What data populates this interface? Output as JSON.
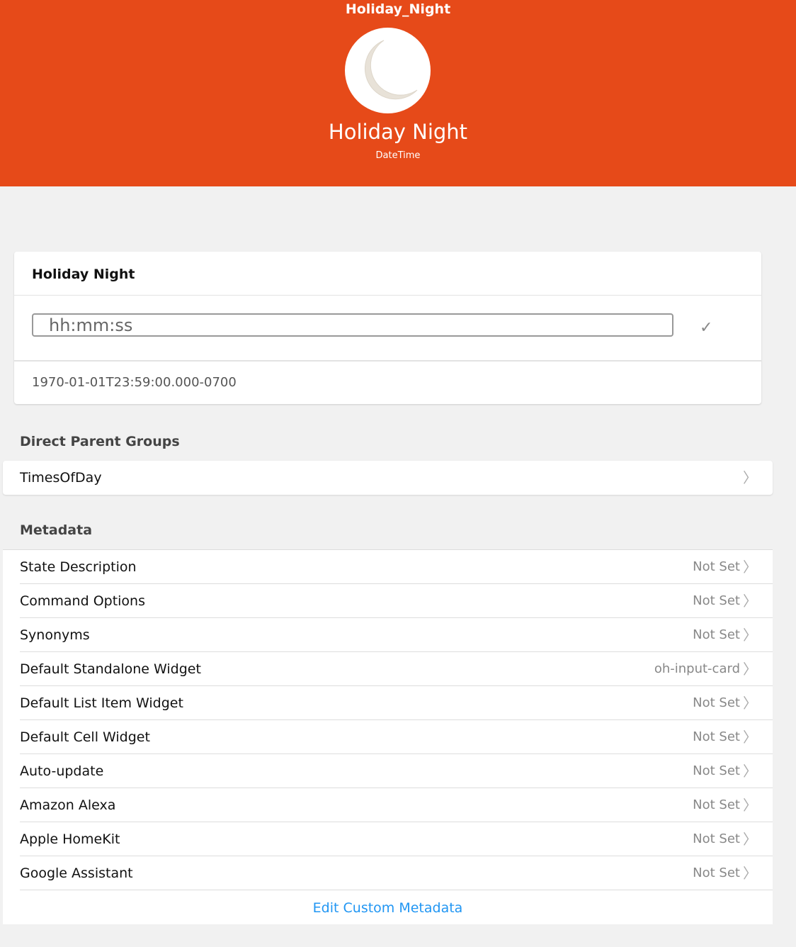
{
  "header": {
    "item_name": "Holiday_Night",
    "label": "Holiday Night",
    "type": "DateTime",
    "accent": "#e64a19",
    "icon": "moon-icon"
  },
  "card": {
    "title": "Holiday Night",
    "input_placeholder": "hh:mm:ss",
    "state": "1970-01-01T23:59:00.000-0700"
  },
  "parent_groups": {
    "heading": "Direct Parent Groups",
    "items": [
      {
        "label": "TimesOfDay"
      }
    ]
  },
  "metadata": {
    "heading": "Metadata",
    "items": [
      {
        "label": "State Description",
        "value": "Not Set"
      },
      {
        "label": "Command Options",
        "value": "Not Set"
      },
      {
        "label": "Synonyms",
        "value": "Not Set"
      },
      {
        "label": "Default Standalone Widget",
        "value": "oh-input-card"
      },
      {
        "label": "Default List Item Widget",
        "value": "Not Set"
      },
      {
        "label": "Default Cell Widget",
        "value": "Not Set"
      },
      {
        "label": "Auto-update",
        "value": "Not Set"
      },
      {
        "label": "Amazon Alexa",
        "value": "Not Set"
      },
      {
        "label": "Apple HomeKit",
        "value": "Not Set"
      },
      {
        "label": "Google Assistant",
        "value": "Not Set"
      }
    ],
    "edit_label": "Edit Custom Metadata"
  }
}
